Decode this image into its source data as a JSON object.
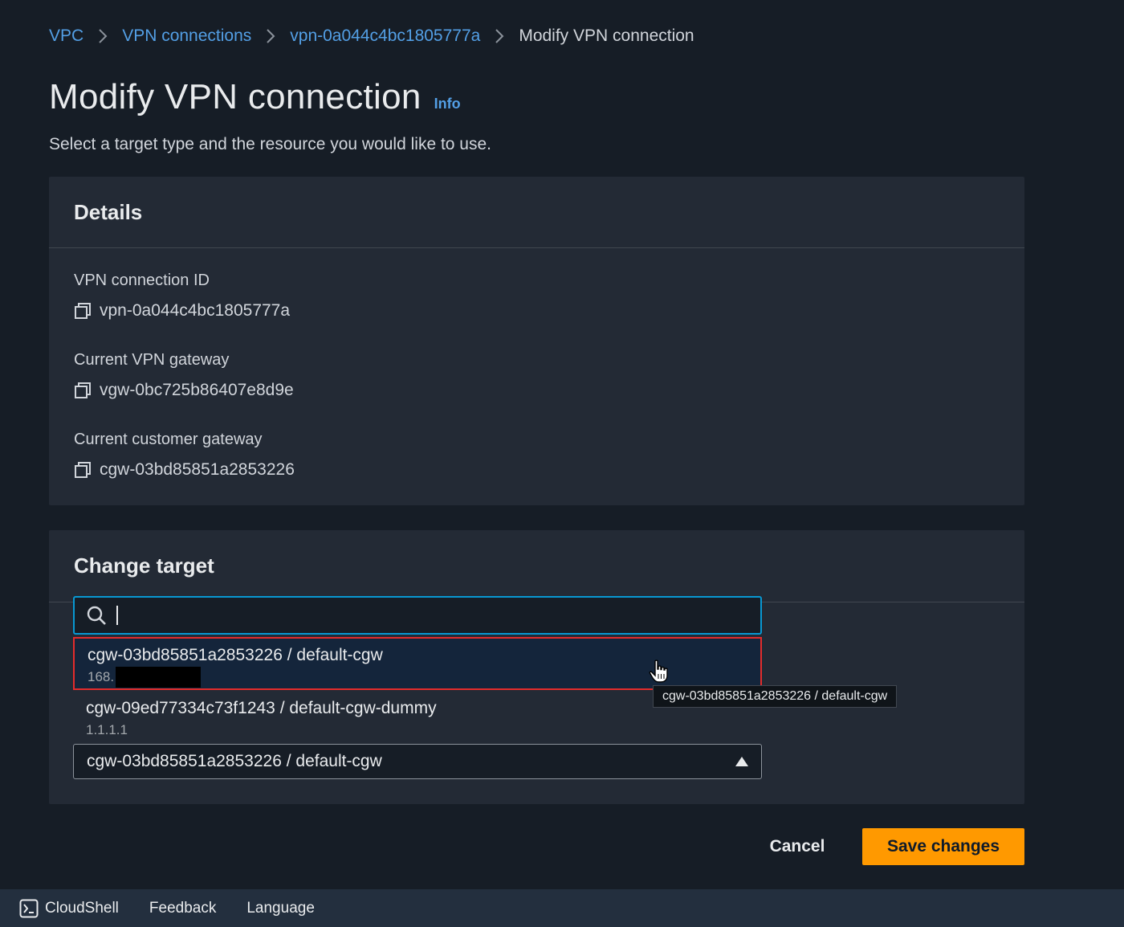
{
  "breadcrumb": {
    "items": [
      "VPC",
      "VPN connections",
      "vpn-0a044c4bc1805777a"
    ],
    "current": "Modify VPN connection"
  },
  "page": {
    "title": "Modify VPN connection",
    "info": "Info",
    "subtitle": "Select a target type and the resource you would like to use."
  },
  "details": {
    "heading": "Details",
    "fields": [
      {
        "label": "VPN connection ID",
        "value": "vpn-0a044c4bc1805777a"
      },
      {
        "label": "Current VPN gateway",
        "value": "vgw-0bc725b86407e8d9e"
      },
      {
        "label": "Current customer gateway",
        "value": "cgw-03bd85851a2853226"
      }
    ]
  },
  "change_target": {
    "heading": "Change target",
    "search_value": "",
    "options": [
      {
        "main": "cgw-03bd85851a2853226 / default-cgw",
        "sub": "168."
      },
      {
        "main": "cgw-09ed77334c73f1243 / default-cgw-dummy",
        "sub": "1.1.1.1"
      }
    ],
    "selected": "cgw-03bd85851a2853226 / default-cgw",
    "tooltip": "cgw-03bd85851a2853226 / default-cgw"
  },
  "actions": {
    "cancel": "Cancel",
    "save": "Save changes"
  },
  "footer": {
    "items": [
      "CloudShell",
      "Feedback",
      "Language"
    ]
  },
  "colors": {
    "background": "#161d26",
    "panel": "#232a35",
    "link": "#539fe5",
    "primary_button": "#ff9900",
    "focus_border": "#0898d2",
    "highlight_border": "#e32c2c"
  },
  "icons": {
    "copy": "copy-icon",
    "search": "search-icon",
    "dropdown": "caret-up-icon",
    "cloudshell": "cloudshell-icon",
    "cursor": "hand-pointer-icon"
  }
}
